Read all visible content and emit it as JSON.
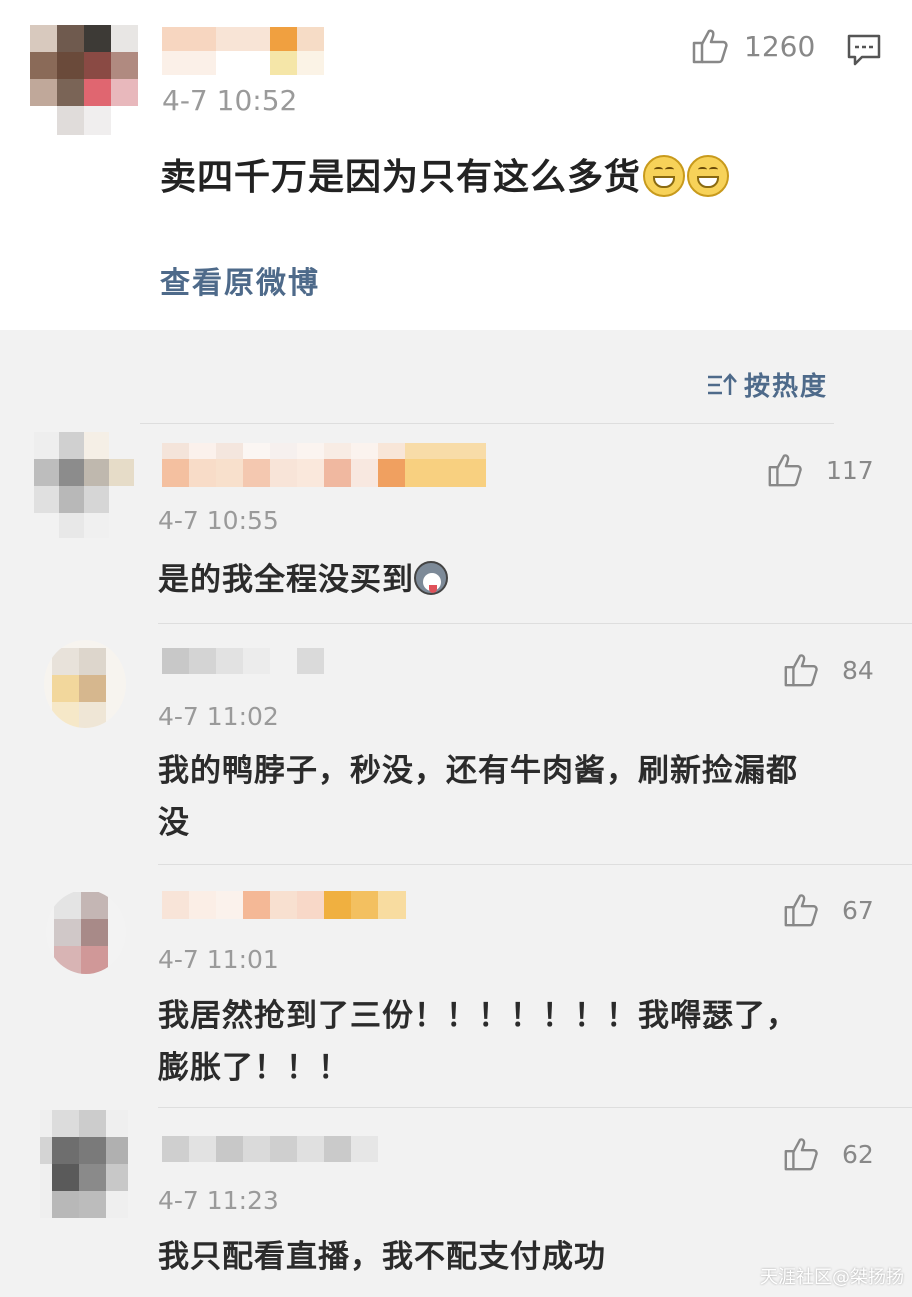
{
  "main_post": {
    "time": "4-7  10:52",
    "like_count": "1260",
    "text": "卖四千万是因为只有这么多货",
    "emoji_icons": [
      "grin-emoji-icon",
      "grin-emoji-icon"
    ],
    "view_original_label": "查看原微博"
  },
  "sort": {
    "label": "按热度",
    "icon": "sort-icon"
  },
  "comments": [
    {
      "time": "4-7  10:55",
      "likes": "117",
      "lines": [
        "是的我全程没买到"
      ],
      "emoji": "husky-emoji-icon"
    },
    {
      "time": "4-7  11:02",
      "likes": "84",
      "lines": [
        "我的鸭脖子，秒没，还有牛肉酱，刷新捡漏都",
        "没"
      ]
    },
    {
      "time": "4-7  11:01",
      "likes": "67",
      "lines": [
        "我居然抢到了三份！！！！！！！我嘚瑟了，",
        "膨胀了！！！"
      ]
    },
    {
      "time": "4-7  11:23",
      "likes": "62",
      "lines": [
        "我只配看直播，我不配支付成功"
      ]
    }
  ],
  "watermark": "天涯社区@桀扬扬",
  "colors": {
    "link": "#4e6a8a",
    "background": "#f2f2f2",
    "post_background": "#ffffff",
    "muted": "#9a9a9a"
  }
}
